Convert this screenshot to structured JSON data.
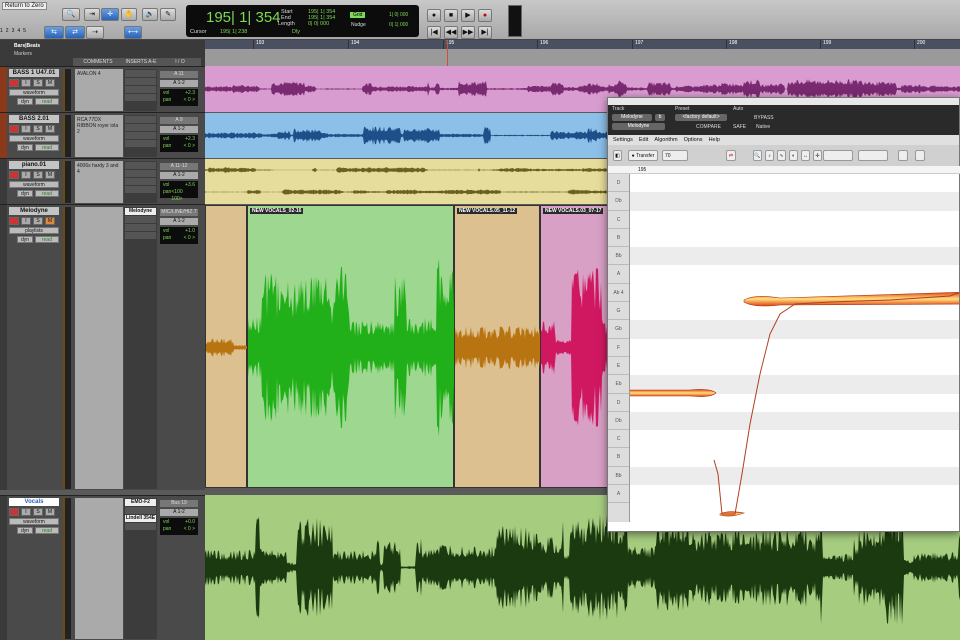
{
  "toolbar": {
    "tooltip": "Return to Zero",
    "main_counter": "195| 1| 354",
    "start_label": "Start",
    "end_label": "End",
    "length_label": "Length",
    "start": "195| 1| 354",
    "end": "195| 1| 354",
    "length": "0| 0| 000",
    "cursor_label": "Cursor",
    "cursor": "195| 1| 238",
    "grid_label": "Grid",
    "grid_value": "1| 0| 000",
    "nudge_label": "Nudge",
    "nudge_value": "0| 1| 000",
    "dly_label": "Dly",
    "track_nums": [
      "1",
      "2",
      "3",
      "4",
      "5"
    ]
  },
  "ruler": {
    "timebase": "Bars|Beats",
    "markers": "Markers",
    "bars": [
      "193",
      "194",
      "195",
      "196",
      "197",
      "198",
      "199",
      "200"
    ]
  },
  "columns": {
    "comments": "COMMENTS",
    "inserts": "INSERTS A-E",
    "io": "I / O"
  },
  "tracks": [
    {
      "name": "BASS 1 U47.01",
      "comment": "AVALON 4",
      "view": "waveform",
      "dyn": "dyn",
      "mode": "read",
      "input": "A 11",
      "output": "A 1-2",
      "vol": "+2.3",
      "pan": "< 0 >",
      "color": "#d89cd0"
    },
    {
      "name": "BASS 2.01",
      "comment": "RCA 77DX RIBBON royer iola 2",
      "view": "waveform",
      "dyn": "dyn",
      "mode": "read",
      "input": "A 9",
      "output": "A 1-2",
      "vol": "+2.3",
      "pan": "< 0 >",
      "color": "#8cc0e8"
    },
    {
      "name": "piano.01",
      "comment": "4006s hardy 3 and 4",
      "view": "waveform",
      "dyn": "dyn",
      "mode": "read",
      "input": "A 11-12",
      "output": "A 1-2",
      "vol": "+3.6",
      "pan": "<100  100>",
      "color": "#e6dc9c"
    },
    {
      "name": "Melodyne",
      "comment": "",
      "view": "playlists",
      "dyn": "dyn",
      "mode": "read",
      "input": "MIC/LINE/HIZ 7",
      "output": "A 1-2",
      "vol": "+1.0",
      "pan": "< 0 >",
      "insert": "Melodyne"
    },
    {
      "name": "Vocals",
      "comment": "",
      "view": "waveform",
      "dyn": "dyn",
      "mode": "read",
      "input": "Bus 19",
      "output": "A 1-2",
      "vol": "+0.0",
      "pan": "< 0 >",
      "inserts": [
        "EMO-F2",
        "Lindell 354E"
      ],
      "color": "#a6cc80"
    }
  ],
  "clips": [
    "NEW VOCALS_02-16",
    "NEW VOCALS.05_11-12",
    "NEW VOCALS.03_07-17"
  ],
  "melodyne": {
    "track_label": "Track",
    "preset_label": "Preset",
    "auto_label": "Auto",
    "track": "Melodyne",
    "track_slot": "b",
    "insert": "Melodyne",
    "preset": "<factory default>",
    "compare": "COMPARE",
    "bypass": "BYPASS",
    "safe": "SAFE",
    "native": "Native",
    "menu": [
      "Settings",
      "Edit",
      "Algorithm",
      "Options",
      "Help"
    ],
    "transfer": "Transfer",
    "tempo": "70",
    "bar": "195",
    "notes": [
      "D",
      "Db",
      "C",
      "B",
      "Bb",
      "A",
      "Ab 4",
      "G",
      "Gb",
      "F",
      "E",
      "Eb",
      "D",
      "Db",
      "C",
      "B",
      "Bb",
      "A"
    ]
  }
}
